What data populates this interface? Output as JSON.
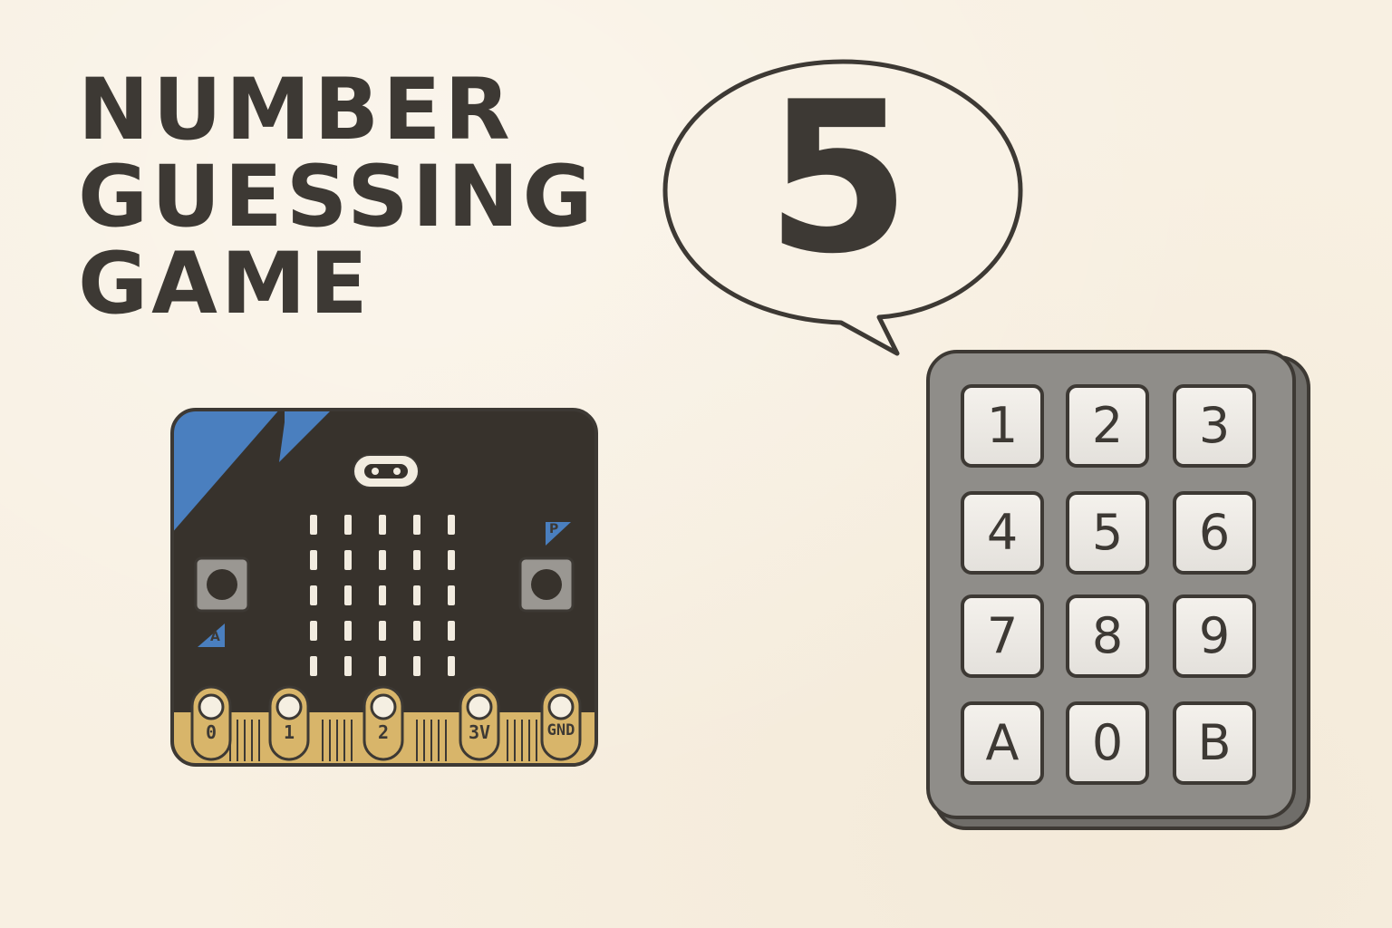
{
  "title": {
    "line1": "NUMBER",
    "line2": "GUESSING",
    "line3": "GAME"
  },
  "speech_bubble": {
    "number": "5"
  },
  "microbit": {
    "button_a_label": "A",
    "button_b_label": "P",
    "pins": [
      "0",
      "1",
      "2",
      "3V",
      "GND"
    ],
    "colors": {
      "board": "#37322c",
      "corner_accent": "#4a7fbf",
      "edge_connector": "#d8b56a",
      "led": "#f2ece0"
    }
  },
  "keypad": {
    "keys": [
      "1",
      "2",
      "3",
      "4",
      "5",
      "6",
      "7",
      "8",
      "9",
      "A",
      "0",
      "B"
    ],
    "colors": {
      "body": "#8f8d89",
      "key_face": "#ece9e4",
      "outline": "#3d3934"
    }
  }
}
